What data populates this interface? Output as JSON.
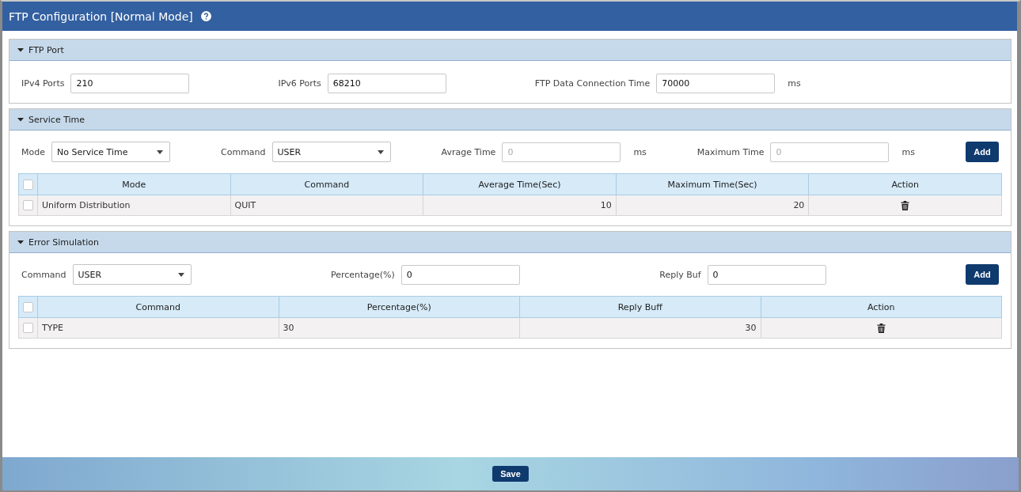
{
  "header": {
    "title": "FTP Configuration [Normal Mode]"
  },
  "sections": [
    {
      "title": "FTP Port",
      "expanded": true,
      "fields": [
        {
          "kind": "text",
          "label": "IPv4 Ports",
          "value": "210"
        },
        {
          "kind": "text",
          "label": "IPv6 Ports",
          "value": "68210"
        },
        {
          "kind": "text",
          "label": "FTP Data Connection Time",
          "value": "70000",
          "unit": "ms"
        }
      ]
    },
    {
      "title": "Service Time",
      "expanded": true,
      "fields": [
        {
          "kind": "select",
          "label": "Mode",
          "value": "No Service Time"
        },
        {
          "kind": "select",
          "label": "Command",
          "value": "USER"
        },
        {
          "kind": "text",
          "label": "Avrage Time",
          "placeholder": "0",
          "unit": "ms"
        },
        {
          "kind": "text",
          "label": "Maximum Time",
          "placeholder": "0",
          "unit": "ms"
        }
      ],
      "add_button": "Add",
      "table": {
        "select_all_checked": false,
        "columns": [
          "Mode",
          "Command",
          "Average Time(Sec)",
          "Maximum Time(Sec)",
          "Action"
        ],
        "rows": [
          {
            "checked": false,
            "cells": [
              "Uniform Distribution",
              "QUIT",
              "10",
              "20"
            ]
          }
        ]
      }
    },
    {
      "title": "Error Simulation",
      "expanded": true,
      "fields": [
        {
          "kind": "select",
          "label": "Command",
          "value": "USER"
        },
        {
          "kind": "text",
          "label": "Percentage(%)",
          "value": "0"
        },
        {
          "kind": "text",
          "label": "Reply Buf",
          "value": "0"
        }
      ],
      "add_button": "Add",
      "table": {
        "select_all_checked": false,
        "columns": [
          "Command",
          "Percentage(%)",
          "Reply Buff",
          "Action"
        ],
        "rows": [
          {
            "checked": false,
            "cells": [
              "TYPE",
              "30",
              "30"
            ]
          }
        ]
      }
    }
  ],
  "footer": {
    "save_button": "Save"
  }
}
